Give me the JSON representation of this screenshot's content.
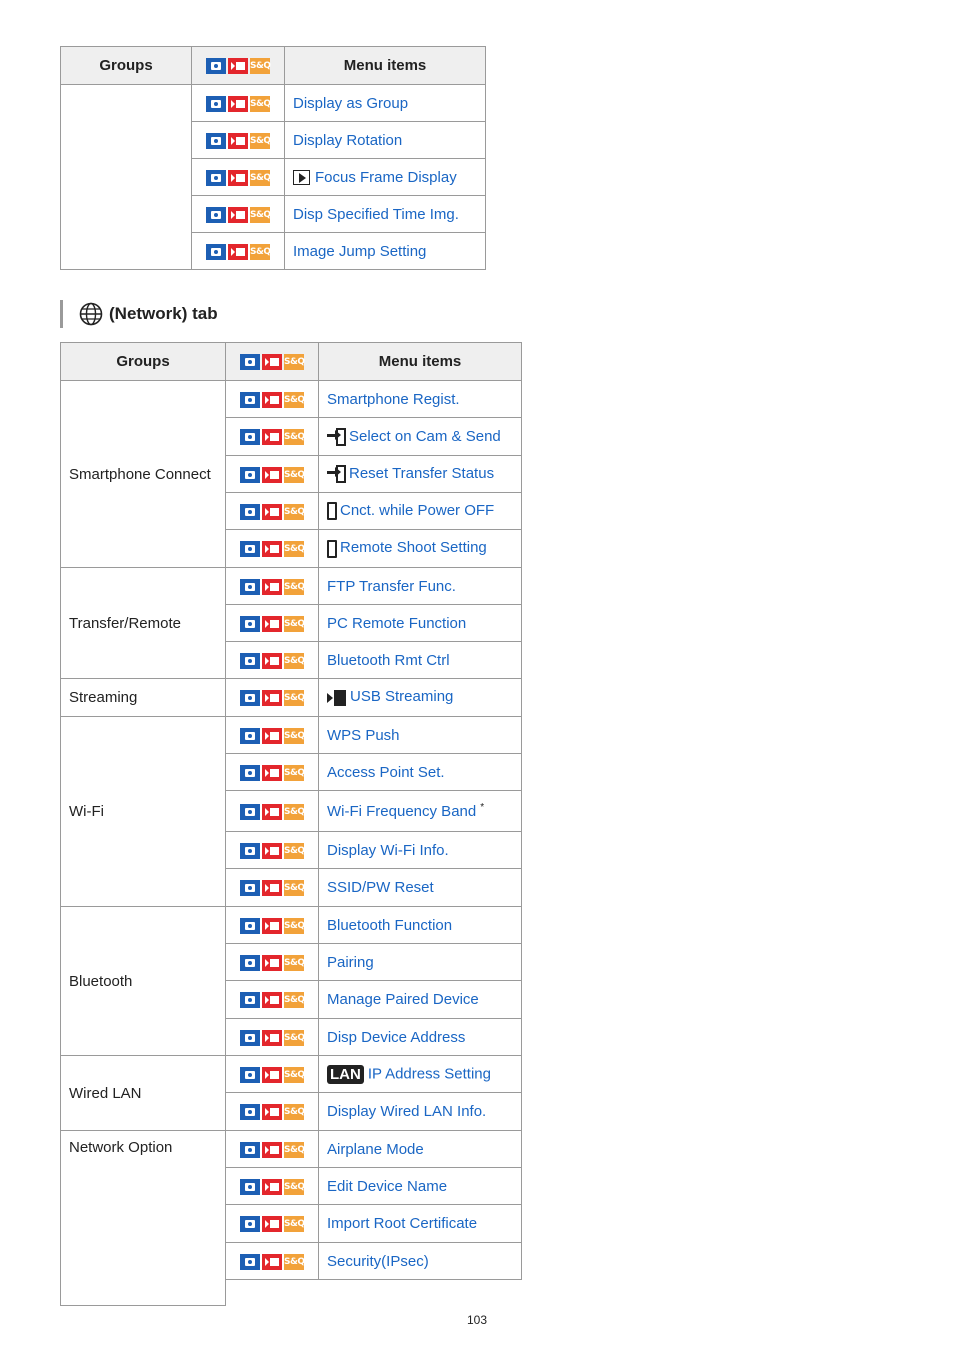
{
  "table1": {
    "headers": {
      "groups": "Groups",
      "menu_items": "Menu items"
    },
    "group_label": "",
    "items": [
      "Display as Group",
      "Display Rotation",
      "Focus Frame Display",
      "Disp Specified Time Img.",
      "Image Jump Setting"
    ]
  },
  "network_tab": {
    "icon": "globe-icon",
    "title": "(Network) tab"
  },
  "table2": {
    "headers": {
      "groups": "Groups",
      "menu_items": "Menu items"
    },
    "groups": [
      {
        "name": "Smartphone Connect",
        "items": [
          "Smartphone Regist.",
          "Select on Cam & Send",
          "Reset Transfer Status",
          "Cnct. while Power OFF",
          "Remote Shoot Setting"
        ]
      },
      {
        "name": "Transfer/Remote",
        "items": [
          "FTP Transfer Func.",
          "PC Remote Function",
          "Bluetooth Rmt Ctrl"
        ]
      },
      {
        "name": "Streaming",
        "items": [
          "USB Streaming"
        ]
      },
      {
        "name": "Wi-Fi",
        "items": [
          "WPS Push",
          "Access Point Set.",
          "Wi-Fi Frequency Band",
          "Display Wi-Fi Info.",
          "SSID/PW Reset"
        ],
        "footnote_mark": "*"
      },
      {
        "name": "Bluetooth",
        "items": [
          "Bluetooth Function",
          "Pairing",
          "Manage Paired Device",
          "Disp Device Address"
        ]
      },
      {
        "name": "Wired LAN",
        "items": [
          "IP Address Setting",
          "Display Wired LAN Info."
        ],
        "lan_badge": "LAN"
      },
      {
        "name": "Network Option",
        "items": [
          "Airplane Mode",
          "Edit Device Name",
          "Import Root Certificate",
          "Security(IPsec)"
        ]
      }
    ]
  },
  "mode_icons": {
    "still": "camera-icon",
    "movie": "movie-icon",
    "sq_label": "S&Q"
  },
  "page_number": "103"
}
